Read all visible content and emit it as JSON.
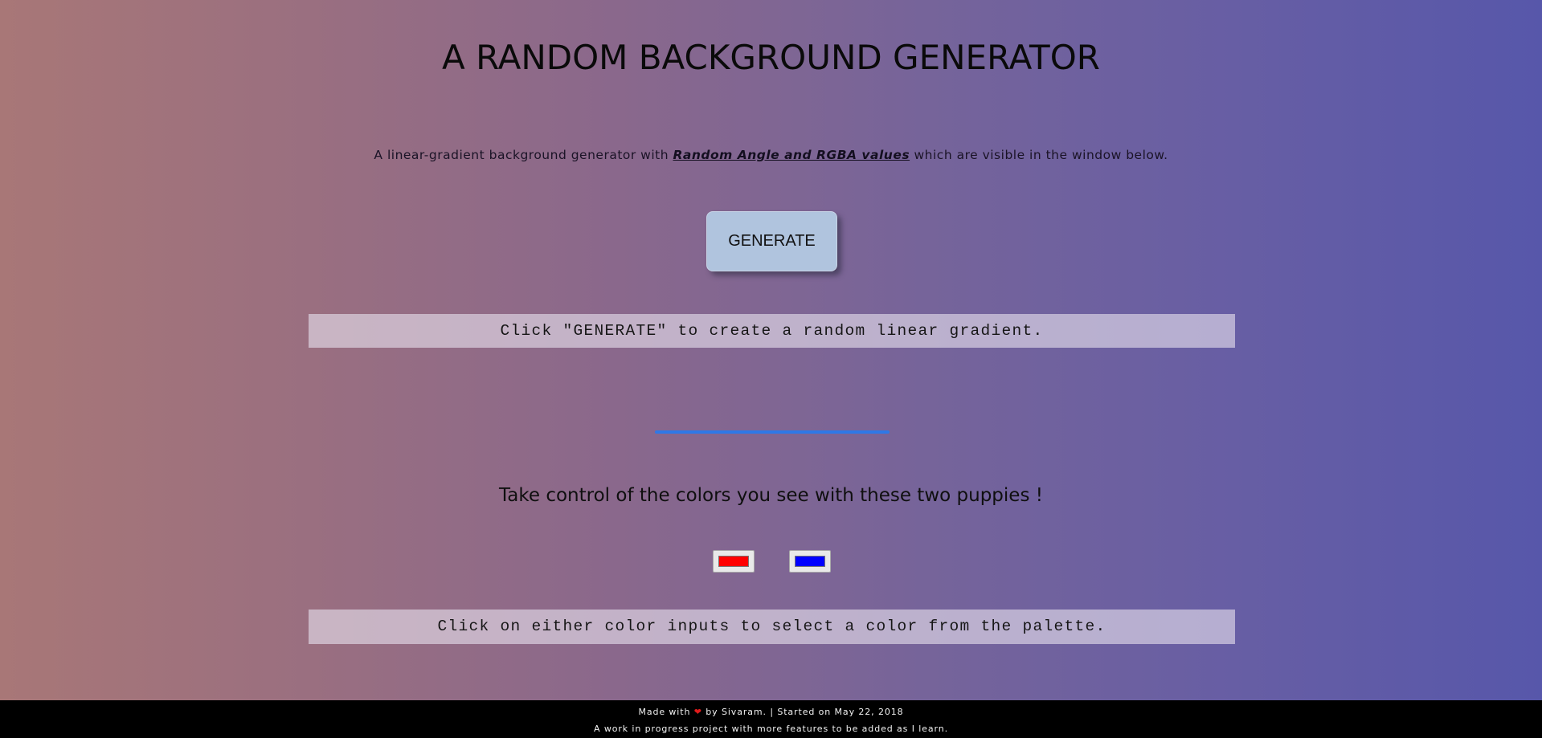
{
  "page": {
    "title": "A RANDOM BACKGROUND GENERATOR",
    "intro_before": "A linear-gradient background generator with ",
    "intro_emphasis": "Random Angle and RGBA values",
    "intro_after": " which are visible in the window below."
  },
  "generate_button": {
    "label": "GENERATE"
  },
  "info_top": {
    "text": "Click \"GENERATE\" to create a random linear gradient."
  },
  "controls": {
    "heading": "Take control of the colors you see with these two puppies !",
    "color_inputs": [
      {
        "value": "#ff0000"
      },
      {
        "value": "#0000ff"
      }
    ]
  },
  "info_bottom": {
    "text": "Click on either color inputs to select a color from the palette."
  },
  "footer": {
    "made_with_prefix": "Made with ",
    "heart_icon": "heart-icon",
    "made_with_suffix": " by Sivaram. | Started on May 22, 2018",
    "line2": "A work in progress project with more features to be added as I learn."
  },
  "colors": {
    "gradient_left": "#a87777",
    "gradient_right": "#5757aa",
    "button_bg": "#b0c4de",
    "divider": "#2f78e6",
    "footer_bg": "#000000",
    "heart": "#e01b1b"
  }
}
